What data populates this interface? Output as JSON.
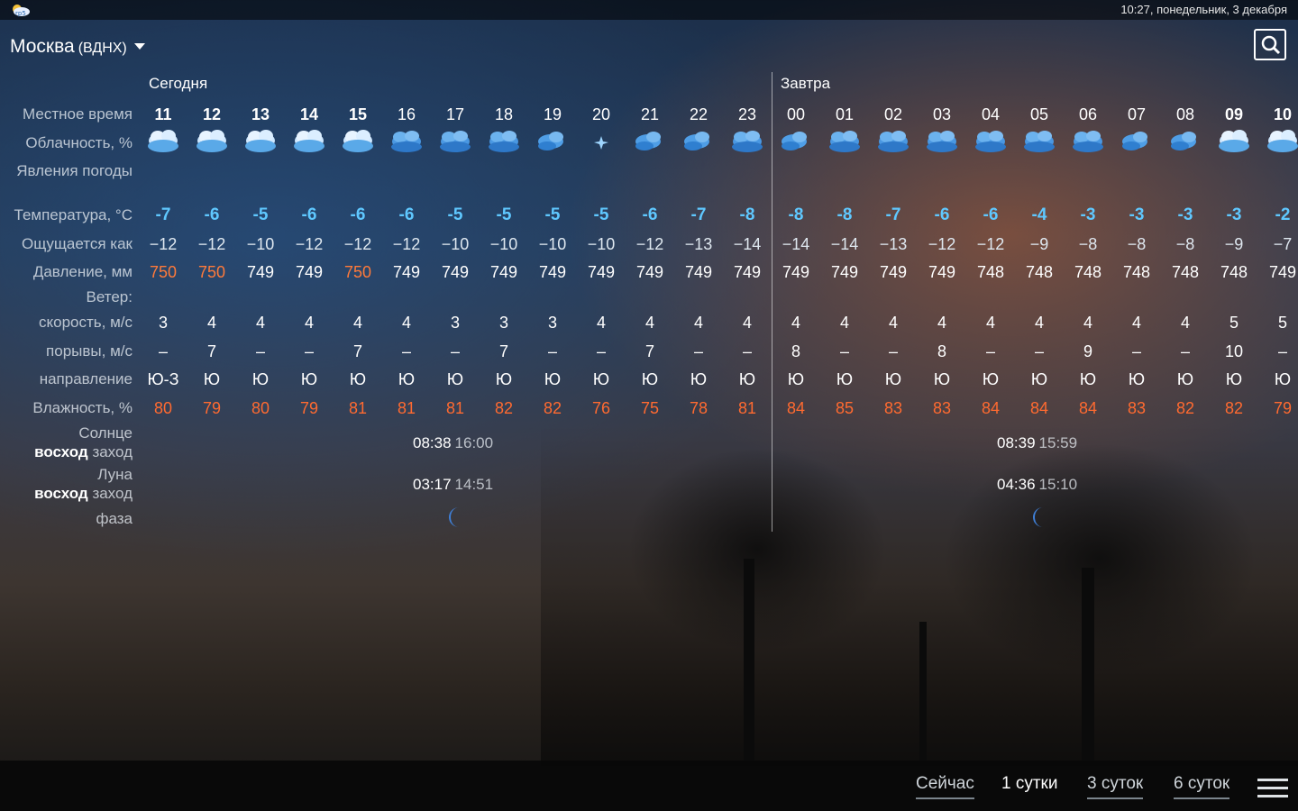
{
  "status": {
    "time": "10:27, понедельник, 3 декабря",
    "app_icon": "weather-app-icon"
  },
  "header": {
    "city": "Москва",
    "station": "(ВДНХ)",
    "search_icon": "search-icon"
  },
  "days": {
    "today": "Сегодня",
    "tomorrow": "Завтра"
  },
  "labels": {
    "local_time": "Местное время",
    "cloudiness": "Облачность, %",
    "phenomena": "Явления погоды",
    "temperature": "Температура, °С",
    "feels_like": "Ощущается как",
    "pressure": "Давление, мм",
    "wind": "Ветер:",
    "speed": "скорость, м/с",
    "gusts": "порывы, м/с",
    "direction": "направление",
    "humidity": "Влажность, %",
    "sun": "Солнце",
    "moon": "Луна",
    "rise": "восход",
    "set": "заход",
    "phase": "фаза"
  },
  "hours": [
    "11",
    "12",
    "13",
    "14",
    "15",
    "16",
    "17",
    "18",
    "19",
    "20",
    "21",
    "22",
    "23",
    "00",
    "01",
    "02",
    "03",
    "04",
    "05",
    "06",
    "07",
    "08",
    "09",
    "10"
  ],
  "cloud_icons": [
    "overcast-icon",
    "overcast-icon",
    "overcast-icon",
    "overcast-icon",
    "overcast-icon",
    "cloudy-night-icon",
    "cloudy-night-icon",
    "cloudy-night-icon",
    "partly-cloudy-night-icon",
    "clear-night-star-icon",
    "partly-cloudy-night-icon",
    "partly-cloudy-night-icon",
    "cloudy-night-icon",
    "partly-cloudy-night-icon",
    "cloudy-night-icon",
    "cloudy-night-icon",
    "cloudy-night-icon",
    "cloudy-night-icon",
    "cloudy-night-icon",
    "cloudy-night-icon",
    "partly-cloudy-night-icon",
    "partly-cloudy-night-icon",
    "overcast-icon",
    "overcast-icon"
  ],
  "temperature": [
    "-7",
    "-6",
    "-5",
    "-6",
    "-6",
    "-6",
    "-5",
    "-5",
    "-5",
    "-5",
    "-6",
    "-7",
    "-8",
    "-8",
    "-8",
    "-7",
    "-6",
    "-6",
    "-4",
    "-3",
    "-3",
    "-3",
    "-3",
    "-2"
  ],
  "feels_like": [
    "−12",
    "−12",
    "−10",
    "−12",
    "−12",
    "−12",
    "−10",
    "−10",
    "−10",
    "−10",
    "−12",
    "−13",
    "−14",
    "−14",
    "−14",
    "−13",
    "−12",
    "−12",
    "−9",
    "−8",
    "−8",
    "−8",
    "−9",
    "−7"
  ],
  "pressure": [
    "750",
    "750",
    "749",
    "749",
    "750",
    "749",
    "749",
    "749",
    "749",
    "749",
    "749",
    "749",
    "749",
    "749",
    "749",
    "749",
    "749",
    "748",
    "748",
    "748",
    "748",
    "748",
    "748",
    "749"
  ],
  "wind_speed": [
    "3",
    "4",
    "4",
    "4",
    "4",
    "4",
    "3",
    "3",
    "3",
    "4",
    "4",
    "4",
    "4",
    "4",
    "4",
    "4",
    "4",
    "4",
    "4",
    "4",
    "4",
    "4",
    "5",
    "5"
  ],
  "wind_gusts": [
    "–",
    "7",
    "–",
    "–",
    "7",
    "–",
    "–",
    "7",
    "–",
    "–",
    "7",
    "–",
    "–",
    "8",
    "–",
    "–",
    "8",
    "–",
    "–",
    "9",
    "–",
    "–",
    "10",
    "–"
  ],
  "wind_dir": [
    "Ю-З",
    "Ю",
    "Ю",
    "Ю",
    "Ю",
    "Ю",
    "Ю",
    "Ю",
    "Ю",
    "Ю",
    "Ю",
    "Ю",
    "Ю",
    "Ю",
    "Ю",
    "Ю",
    "Ю",
    "Ю",
    "Ю",
    "Ю",
    "Ю",
    "Ю",
    "Ю",
    "Ю"
  ],
  "humidity": [
    "80",
    "79",
    "80",
    "79",
    "81",
    "81",
    "81",
    "82",
    "82",
    "76",
    "75",
    "78",
    "81",
    "84",
    "85",
    "83",
    "83",
    "84",
    "84",
    "84",
    "83",
    "82",
    "82",
    "79"
  ],
  "astro": {
    "today": {
      "sunrise": "08:38",
      "sunset": "16:00",
      "moonrise": "03:17",
      "moonset": "14:51",
      "moon_phase_icon": "crescent-moon-icon"
    },
    "tomorrow": {
      "sunrise": "08:39",
      "sunset": "15:59",
      "moonrise": "04:36",
      "moonset": "15:10",
      "moon_phase_icon": "crescent-moon-icon"
    }
  },
  "tabs": {
    "now": "Сейчас",
    "one_day": "1 сутки",
    "three_days": "3 суток",
    "six_days": "6 суток",
    "active": "one_day"
  },
  "colors": {
    "temperature": "#5fc8ff",
    "high_pressure": "#ff7a3a",
    "humidity": "#ff6a30"
  }
}
